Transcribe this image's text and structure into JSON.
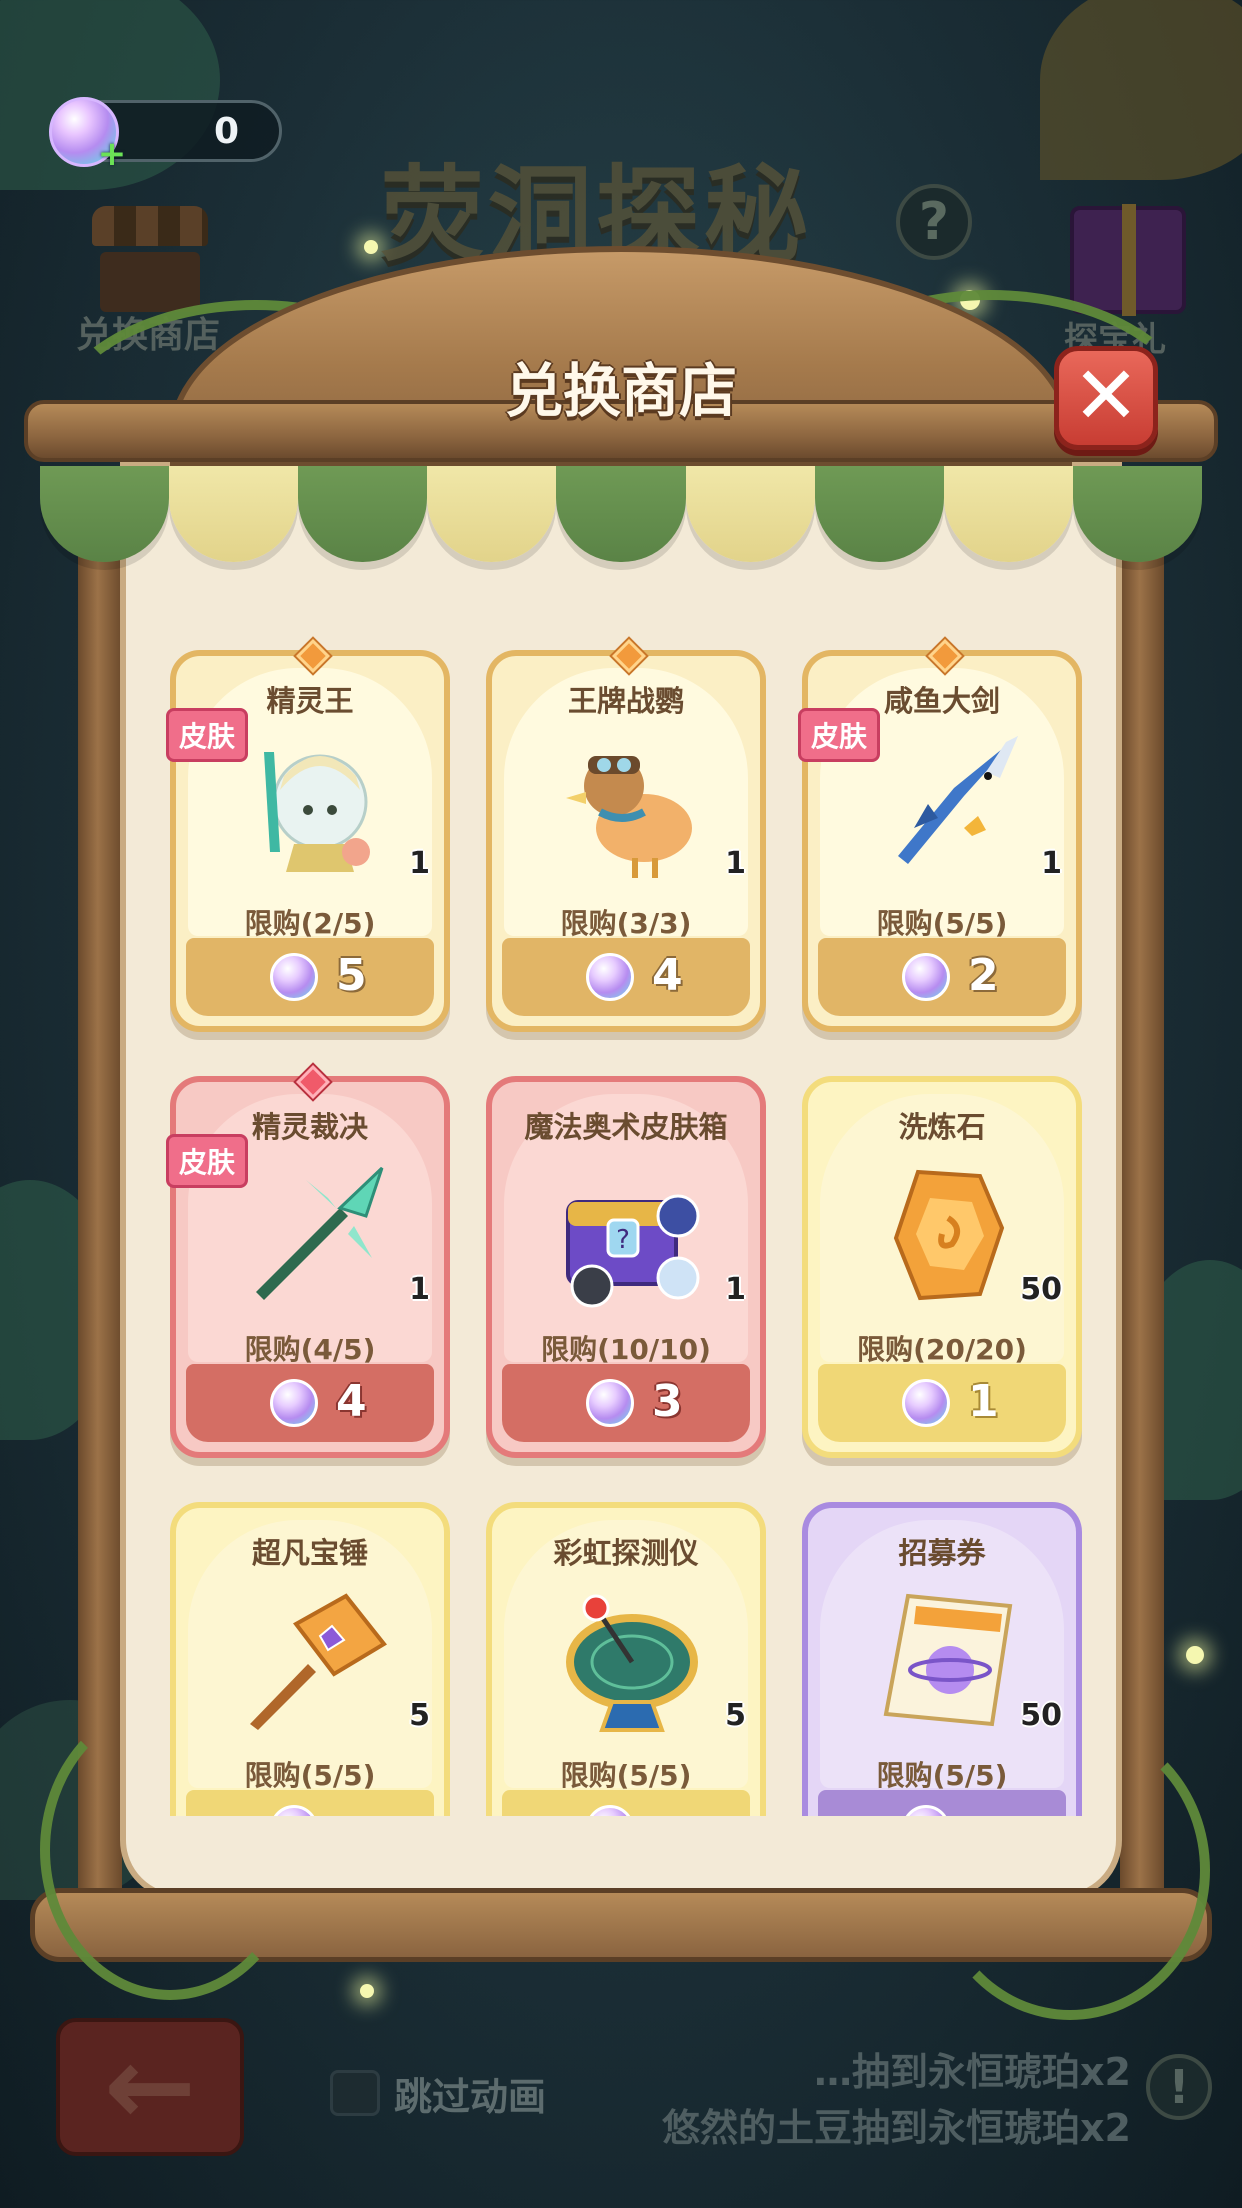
{
  "hud": {
    "currency_amount": "0",
    "event_title": "荧洞探秘",
    "help_icon": "question-icon",
    "shop_shortcut_label": "兑换商店",
    "gift_shortcut_label": "探宝礼"
  },
  "modal": {
    "title": "兑换商店",
    "close_icon": "close-icon"
  },
  "items": [
    {
      "name": "精灵王",
      "skin": "皮肤",
      "count": "1",
      "limit": "限购(2/5)",
      "price": "5",
      "style": "gold"
    },
    {
      "name": "王牌战鹦",
      "skin": "",
      "count": "1",
      "limit": "限购(3/3)",
      "price": "4",
      "style": "gold"
    },
    {
      "name": "咸鱼大剑",
      "skin": "皮肤",
      "count": "1",
      "limit": "限购(5/5)",
      "price": "2",
      "style": "gold"
    },
    {
      "name": "精灵裁决",
      "skin": "皮肤",
      "count": "1",
      "limit": "限购(4/5)",
      "price": "4",
      "style": "red"
    },
    {
      "name": "魔法奥术皮肤箱",
      "skin": "",
      "count": "1",
      "limit": "限购(10/10)",
      "price": "3",
      "style": "red"
    },
    {
      "name": "洗炼石",
      "skin": "",
      "count": "50",
      "limit": "限购(20/20)",
      "price": "1",
      "style": "yellow"
    },
    {
      "name": "超凡宝锤",
      "skin": "",
      "count": "5",
      "limit": "限购(5/5)",
      "price": "",
      "style": "yellow"
    },
    {
      "name": "彩虹探测仪",
      "skin": "",
      "count": "5",
      "limit": "限购(5/5)",
      "price": "",
      "style": "yellow"
    },
    {
      "name": "招募券",
      "skin": "",
      "count": "50",
      "limit": "限购(5/5)",
      "price": "",
      "style": "purple"
    }
  ],
  "footer": {
    "skip_label": "跳过动画",
    "log_line_1": "…抽到永恒琥珀x2",
    "log_line_2": "悠然的土豆抽到永恒琥珀x2"
  },
  "colors": {
    "accent_gold": "#e3b663",
    "accent_red": "#e47a7a",
    "accent_yellow": "#f3dc7c",
    "accent_purple": "#a98be0",
    "close_red": "#d44a3e"
  }
}
